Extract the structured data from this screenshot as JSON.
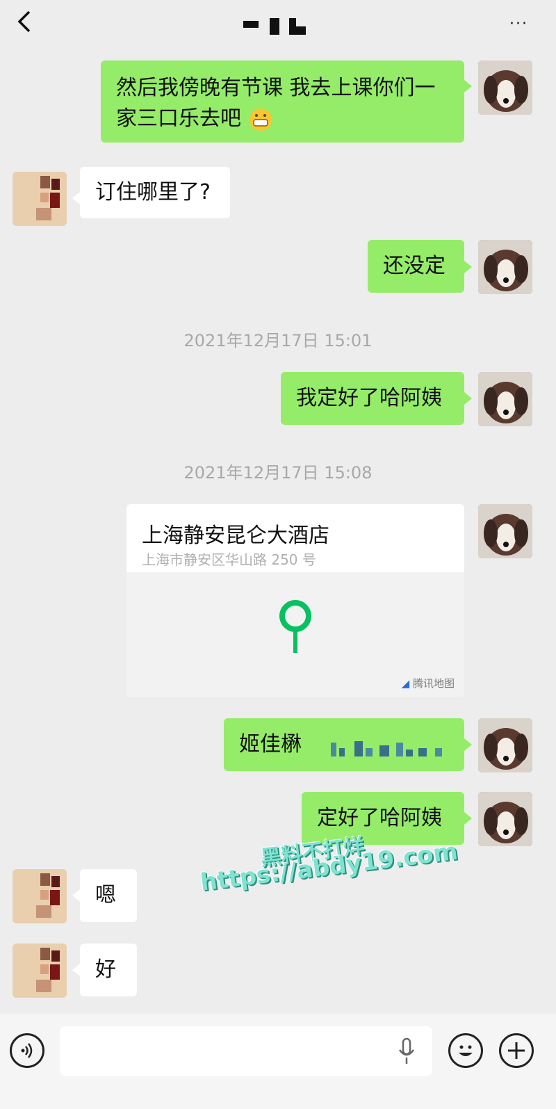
{
  "header": {
    "back_icon": "chevron-left-icon",
    "more_label": "···"
  },
  "messages": [
    {
      "side": "right",
      "text": "然后我傍晚有节课 我去上课你们一家三口乐去吧",
      "emoji": "grinning-face-icon"
    },
    {
      "side": "left",
      "text": "订住哪里了?"
    },
    {
      "side": "right",
      "text": "还没定"
    },
    {
      "type": "timestamp",
      "text": "2021年12月17日 15:01"
    },
    {
      "side": "right",
      "text": "我定好了哈阿姨"
    },
    {
      "type": "timestamp",
      "text": "2021年12月17日 15:08"
    },
    {
      "side": "right",
      "type": "location",
      "name": "上海静安昆仑大酒店",
      "address": "上海市静安区华山路 250 号",
      "map_source": "腾讯地图"
    },
    {
      "side": "right",
      "text": "姬佳楙"
    },
    {
      "side": "right",
      "text": "定好了哈阿姨"
    },
    {
      "side": "left",
      "text": "嗯"
    },
    {
      "side": "left",
      "text": "好"
    }
  ],
  "watermark": {
    "line1": "黑料不打烊",
    "line2": "https://abdy19.com"
  },
  "input_bar": {
    "voice_icon": "voice-icon",
    "mic_icon": "microphone-icon",
    "emoji_icon": "emoji-icon",
    "plus_icon": "plus-icon"
  },
  "colors": {
    "bubble_green": "#95ec69",
    "bubble_white": "#ffffff",
    "background": "#ededed"
  }
}
